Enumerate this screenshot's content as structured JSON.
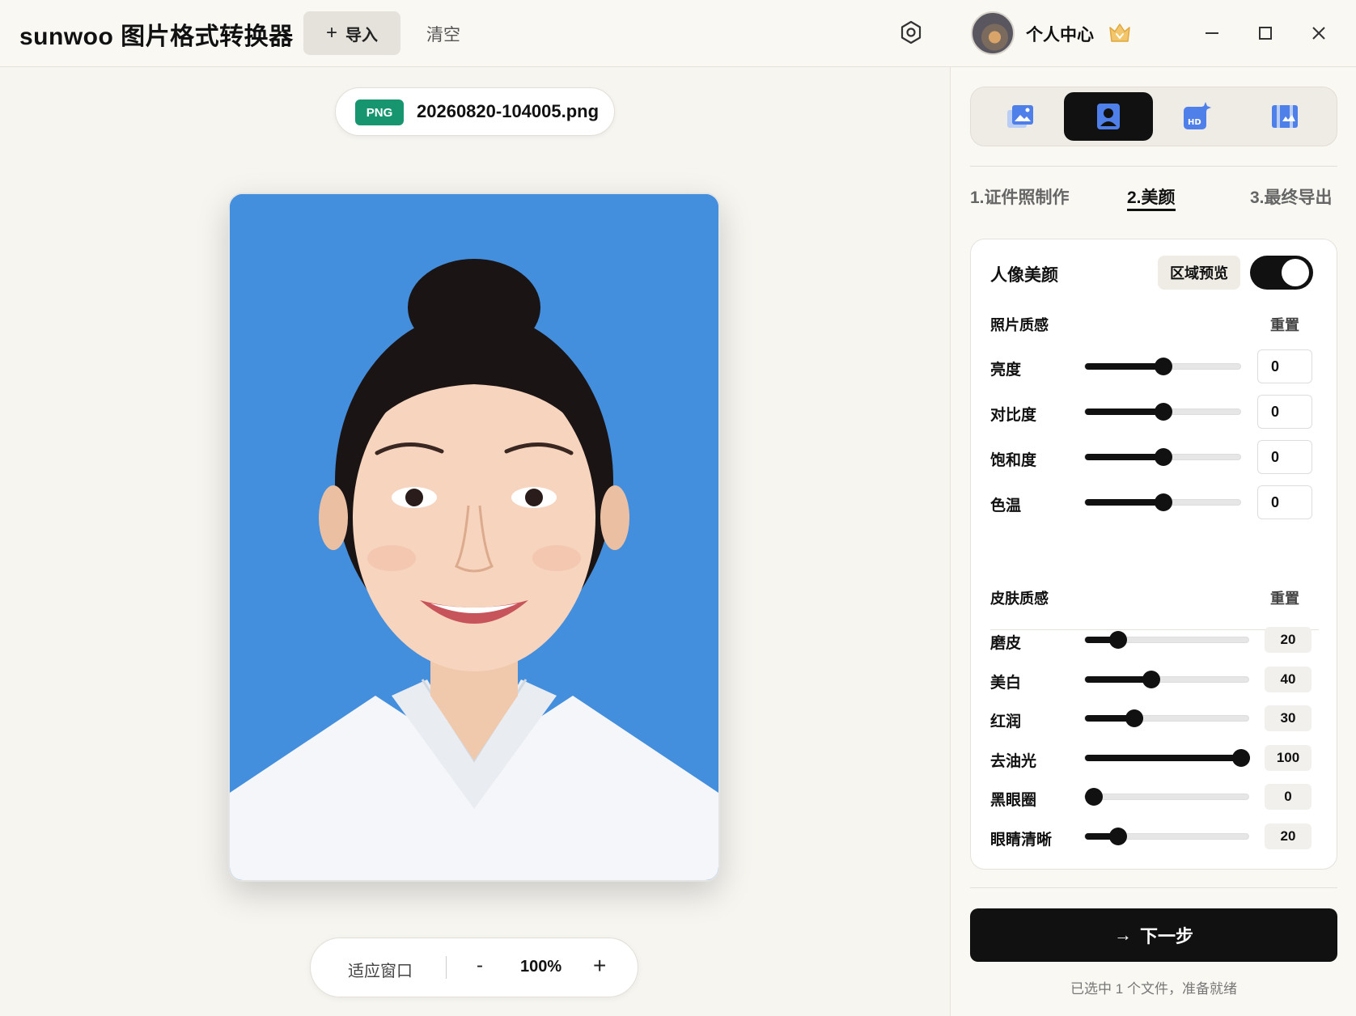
{
  "header": {
    "app_title": "sunwoo 图片格式转换器",
    "import_label": "导入",
    "clear_label": "清空",
    "profile_label": "个人中心"
  },
  "file": {
    "format_badge": "PNG",
    "name": "20260820-104005.png"
  },
  "zoom": {
    "fit_label": "适应窗口",
    "minus": "-",
    "value": "100%",
    "plus": "+"
  },
  "tools": [
    {
      "icon": "image-convert-icon"
    },
    {
      "icon": "id-photo-icon",
      "active": true
    },
    {
      "icon": "hd-enhance-icon"
    },
    {
      "icon": "image-compare-icon"
    }
  ],
  "steps": [
    {
      "label": "1.证件照制作"
    },
    {
      "label": "2.美颜",
      "active": true
    },
    {
      "label": "3.最终导出"
    }
  ],
  "beauty": {
    "title": "人像美颜",
    "area_preview": "区域预览",
    "enabled": true,
    "photo_quality": {
      "title": "照片质感",
      "reset": "重置",
      "sliders": [
        {
          "label": "亮度",
          "value": "0",
          "position": 0.5
        },
        {
          "label": "对比度",
          "value": "0",
          "position": 0.5
        },
        {
          "label": "饱和度",
          "value": "0",
          "position": 0.5
        },
        {
          "label": "色温",
          "value": "0",
          "position": 0.5
        }
      ]
    },
    "skin_quality": {
      "title": "皮肤质感",
      "reset": "重置",
      "sliders": [
        {
          "label": "磨皮",
          "value": "20",
          "position": 0.2
        },
        {
          "label": "美白",
          "value": "40",
          "position": 0.4
        },
        {
          "label": "红润",
          "value": "30",
          "position": 0.3
        },
        {
          "label": "去油光",
          "value": "100",
          "position": 1.0
        },
        {
          "label": "黑眼圈",
          "value": "0",
          "position": 0.0
        },
        {
          "label": "眼睛清晰",
          "value": "20",
          "position": 0.2
        }
      ]
    }
  },
  "footer": {
    "next_label": "下一步",
    "status": "已选中 1 个文件，准备就绪"
  },
  "colors": {
    "accent": "#111111",
    "badge_green": "#17956f",
    "photo_bg": "#448fdd"
  }
}
